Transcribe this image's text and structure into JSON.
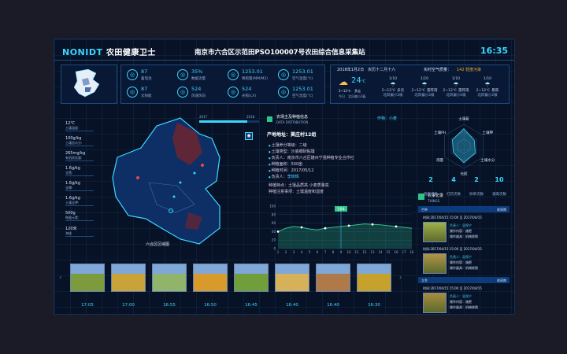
{
  "header": {
    "brand": "NONIDT",
    "brand_cn": "农田健康卫士",
    "title": "南京市六合区示范田PSO100007号农田综合信息采集站",
    "clock": "16:35"
  },
  "metrics": [
    {
      "value": "87",
      "label": "蓄电池",
      "icon": "battery-icon"
    },
    {
      "value": "35%",
      "label": "数据流量",
      "icon": "data-icon"
    },
    {
      "value": "1253.01",
      "label": "降雨量(MM/M2)",
      "icon": "rain-icon"
    },
    {
      "value": "1253.01",
      "label": "空气温度(℃)",
      "icon": "thermometer-icon"
    },
    {
      "value": "87",
      "label": "太阳能",
      "icon": "solar-icon"
    },
    {
      "value": "524",
      "label": "风速风向",
      "icon": "wind-icon"
    },
    {
      "value": "524",
      "label": "光照(LX)",
      "icon": "light-icon"
    },
    {
      "value": "1253.01",
      "label": "空气湿度(℃)",
      "icon": "humidity-icon"
    }
  ],
  "weather": {
    "date": "2018年1月2日　农历十二月十六",
    "air_label": "实时空气质量：",
    "air_value": "142 轻度污染",
    "today_temp": "24",
    "today_unit": "℃",
    "today_desc": "多云",
    "today_range": "2~12℃",
    "today_wind": "今日　北风偏小2级",
    "days": [
      {
        "date": "1/10",
        "range": "2~12℃",
        "desc": "多云",
        "wind": "北风偏小2级"
      },
      {
        "date": "1/10",
        "range": "2~12℃",
        "desc": "雷阵雨",
        "wind": "北风偏小2级"
      },
      {
        "date": "1/10",
        "range": "2~12℃",
        "desc": "雷阵雨",
        "wind": "北风偏小2级"
      },
      {
        "date": "1/10",
        "range": "2~12℃",
        "desc": "暴雨",
        "wind": "北风偏小2级"
      }
    ]
  },
  "left_stats": [
    {
      "value": "12℃",
      "label": "土壤温度:"
    },
    {
      "value": "100g/kg",
      "label": "土壤含水分:"
    },
    {
      "value": "265mg/kg",
      "label": "有机质含量:"
    },
    {
      "value": "1.6g/kg",
      "label": "全氮:"
    },
    {
      "value": "1.6g/kg",
      "label": "全磷:"
    },
    {
      "value": "1.6g/kg",
      "label": "土壤全钾:"
    },
    {
      "value": "500g",
      "label": "微量元素:"
    },
    {
      "value": "120米",
      "label": "海拔"
    }
  ],
  "map": {
    "label": "六合区区域图",
    "timeline_start": "2017",
    "timeline_end": "2018"
  },
  "info": {
    "title": "农场主及种植信息",
    "subtitle": "DATA DISTRIBUTION",
    "crop_label": "作物：小麦",
    "place": "产地地址：莫庄村12组",
    "rows": [
      {
        "k": "土壤养分等级：",
        "v": "二级"
      },
      {
        "k": "土壤类型：",
        "v": "沙底细砂粘壤"
      },
      {
        "k": "负责人：",
        "v": "南京市六合区雄州宁强种植专业合作社"
      },
      {
        "k": "种植面积：",
        "v": "500亩"
      },
      {
        "k": "种植时间：",
        "v": "2017/05/12"
      },
      {
        "k": "负责人：",
        "v": "李晓辉"
      }
    ],
    "notes": [
      {
        "k": "种植特点：",
        "v": "土壤品质高 小麦质量高"
      },
      {
        "k": "种植注意事项：",
        "v": "土壤温度和湿度"
      }
    ]
  },
  "chart_data": {
    "type": "line",
    "x": [
      1,
      2,
      3,
      4,
      5,
      6,
      7,
      8,
      9,
      10,
      11,
      12,
      13,
      14,
      15,
      16,
      17,
      18
    ],
    "values": [
      40,
      48,
      52,
      50,
      46,
      44,
      48,
      50,
      52,
      54,
      56,
      58,
      57,
      56,
      54,
      52,
      50,
      48
    ],
    "ylim": [
      0,
      100
    ],
    "yticks": [
      0,
      20,
      40,
      60,
      80,
      100
    ],
    "marker_label": "584",
    "marker_x": 9
  },
  "radar": {
    "labels": [
      "土壤氮",
      "土壤钾",
      "土壤水分",
      "光照",
      "雨量",
      "土壤PH"
    ]
  },
  "stats": [
    {
      "value": "2",
      "label": "施肥次数"
    },
    {
      "value": "4",
      "label": "打药次数"
    },
    {
      "value": "2",
      "label": "除草次数"
    },
    {
      "value": "10",
      "label": "灌溉次数"
    }
  ],
  "records": {
    "title": "农事记录",
    "subtitle": "THINGS",
    "tab1": "芒种",
    "tab2": "收获期",
    "items": [
      {
        "time": "时间:2017/04/15 15:00 至 2017/04/15",
        "who": "负责人：吴保宁",
        "op": "操作内容：施肥",
        "tool": "操作器具：机械收割"
      },
      {
        "time": "时间:2017/04/15 15:00 至 2017/04/15",
        "who": "负责人：吴保宁",
        "op": "操作内容：施肥",
        "tool": "操作器具：机械收割"
      },
      {
        "time": "时间:2017/04/15 15:00 至 2017/04/15",
        "who": "负责人：吴保宁",
        "op": "操作内容：施肥",
        "tool": "操作器具：机械收割"
      }
    ],
    "tab3": "立冬",
    "tab4": "收获期"
  },
  "gallery": [
    {
      "time": "17:05",
      "color": "#7b9b3c"
    },
    {
      "time": "17:00",
      "color": "#c9a23a"
    },
    {
      "time": "16:55",
      "color": "#8fb46a"
    },
    {
      "time": "16:50",
      "color": "#d89a2a"
    },
    {
      "time": "16:45",
      "color": "#6f9e3b"
    },
    {
      "time": "16:40",
      "color": "#d7b05a"
    },
    {
      "time": "16:40",
      "color": "#b07a48"
    },
    {
      "time": "16:30",
      "color": "#c6a22c"
    }
  ],
  "colors": {
    "accent": "#3dd6ff",
    "panel": "#081a38",
    "bg": "#071226"
  }
}
